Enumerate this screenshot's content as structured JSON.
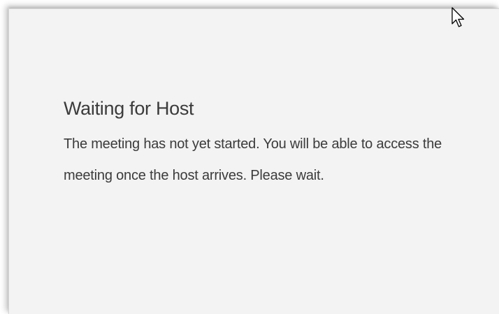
{
  "dialog": {
    "title": "Waiting for Host",
    "message": "The meeting has not yet started. You will be able to access the meeting once the host arrives. Please wait."
  },
  "cursor": {
    "icon": "mouse-pointer-icon"
  },
  "colors": {
    "background": "#f3f3f3",
    "text": "#3b3b3b"
  }
}
